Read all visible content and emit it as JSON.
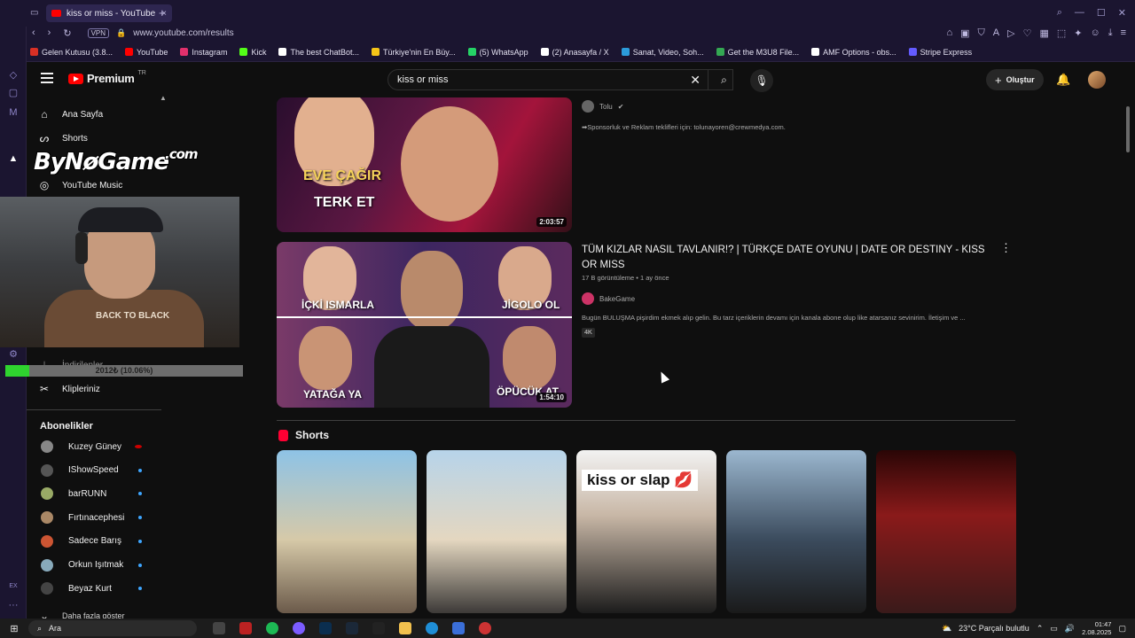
{
  "browser": {
    "tab_title": "kiss or miss - YouTube",
    "url": "www.youtube.com/results",
    "vpn_label": "VPN",
    "bookmarks": [
      {
        "label": "Gelen Kutusu (3.8...",
        "color": "#d93025"
      },
      {
        "label": "YouTube",
        "color": "#ff0000"
      },
      {
        "label": "Instagram",
        "color": "#e1306c"
      },
      {
        "label": "Kick",
        "color": "#53fc18"
      },
      {
        "label": "The best ChatBot...",
        "color": "#ffffff"
      },
      {
        "label": "Türkiye'nin En Büy...",
        "color": "#f5c518"
      },
      {
        "label": "(5) WhatsApp",
        "color": "#25d366"
      },
      {
        "label": "(2) Anasayfa / X",
        "color": "#ffffff"
      },
      {
        "label": "Sanat, Video, Soh...",
        "color": "#2c9cdb"
      },
      {
        "label": "Get the M3U8 File...",
        "color": "#34a853"
      },
      {
        "label": "AMF Options - obs...",
        "color": "#ffffff"
      },
      {
        "label": "Stripe Express",
        "color": "#635bff"
      }
    ]
  },
  "header": {
    "logo_text": "Premium",
    "logo_region": "TR",
    "search_value": "kiss or miss",
    "create_label": "Oluştur"
  },
  "sidebar": {
    "items": [
      {
        "label": "Ana Sayfa",
        "icon": "home-icon"
      },
      {
        "label": "Shorts",
        "icon": "shorts-icon"
      },
      {
        "label": "YouTube Music",
        "icon": "music-icon"
      },
      {
        "label": "İndirilenler",
        "icon": "download-icon"
      },
      {
        "label": "Klipleriniz",
        "icon": "scissors-icon"
      }
    ],
    "subscriptions_title": "Abonelikler",
    "subscriptions": [
      {
        "name": "Kuzey Güney",
        "color": "#888",
        "live": true
      },
      {
        "name": "IShowSpeed",
        "color": "#555",
        "live": false
      },
      {
        "name": "barRUNN",
        "color": "#9a6",
        "live": false
      },
      {
        "name": "Fırtınacephesi",
        "color": "#a86",
        "live": false
      },
      {
        "name": "Sadece Barış",
        "color": "#c53",
        "live": false
      },
      {
        "name": "Orkun Işıtmak",
        "color": "#8ab",
        "live": false
      },
      {
        "name": "Beyaz Kurt",
        "color": "#444",
        "live": false
      }
    ],
    "show_more": "Daha fazla göster"
  },
  "overlay": {
    "logo": "ByNøGame",
    "logo_suffix": ".com",
    "shirt_text": "BACK TO BLACK",
    "progress_label": "2012₺ (10.06%)",
    "progress_fraction": 0.1006
  },
  "results": [
    {
      "thumb_text_1": "EVE ÇAĞIR",
      "thumb_text_2": "TERK ET",
      "duration": "2:03:57",
      "channel": "Tolu",
      "description": "➡Sponsorluk ve Reklam teklifleri için: tolunayoren@crewmedya.com."
    },
    {
      "title": "TÜM KIZLAR NASIL TAVLANIR!? | TÜRKÇE DATE OYUNU | DATE OR DESTINY - KISS OR MISS",
      "meta": "17 B görüntüleme • 1 ay önce",
      "channel": "BakeGame",
      "description": "Bugün BULUŞMA pişirdim ekmek alıp gelin. Bu tarz içeriklerin devamı için kanala abone olup like atarsanız sevinirim. İletişim ve ...",
      "badge": "4K",
      "duration": "1:54:10",
      "thumb_labels": [
        "İÇKİ ISMARLA",
        "JİGOLO OL",
        "YATAĞA YA",
        "ÖPÜCÜK AT"
      ]
    }
  ],
  "shorts": {
    "heading": "Shorts",
    "items": [
      {
        "caption": ""
      },
      {
        "caption": ""
      },
      {
        "caption": "kiss or slap 💋"
      },
      {
        "caption": ""
      },
      {
        "caption": ""
      }
    ]
  },
  "taskbar": {
    "search_placeholder": "Ara",
    "weather": "23°C  Parçalı bulutlu",
    "time": "01:47",
    "date": "2.08.2025"
  }
}
